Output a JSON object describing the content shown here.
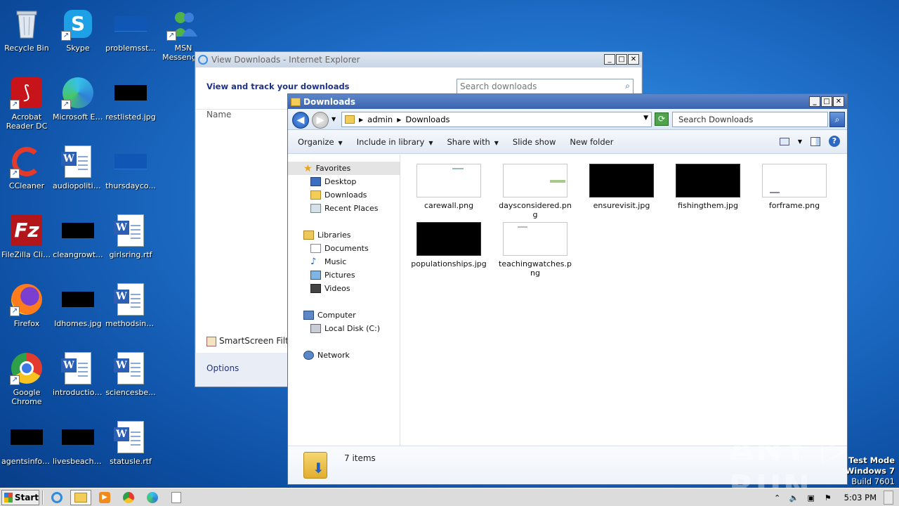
{
  "desktop": {
    "icons": [
      {
        "label": "Recycle Bin"
      },
      {
        "label": "Skype"
      },
      {
        "label": "problemsst..."
      },
      {
        "label": "MSN Messenger"
      },
      {
        "label": "Acrobat Reader DC"
      },
      {
        "label": "Microsoft Edge"
      },
      {
        "label": "restlisted.jpg"
      },
      {
        "label": "CCleaner"
      },
      {
        "label": "audiopolitic..."
      },
      {
        "label": "thursdayco..."
      },
      {
        "label": "FileZilla Client"
      },
      {
        "label": "cleangrowt..."
      },
      {
        "label": "girlsring.rtf"
      },
      {
        "label": "Firefox"
      },
      {
        "label": "ldhomes.jpg"
      },
      {
        "label": "methodsinc.rtf"
      },
      {
        "label": "Google Chrome"
      },
      {
        "label": "introduction..."
      },
      {
        "label": "sciencesbe..."
      },
      {
        "label": "agentsinfo.jpg"
      },
      {
        "label": "livesbeach.jpg"
      },
      {
        "label": "statusle.rtf"
      }
    ]
  },
  "ie_window": {
    "title": "View Downloads - Internet Explorer",
    "heading": "View and track your downloads",
    "search_placeholder": "Search downloads",
    "column_name": "Name",
    "smartscreen": "SmartScreen Filte",
    "options": "Options"
  },
  "explorer": {
    "title": "Downloads",
    "breadcrumb": [
      "admin",
      "Downloads"
    ],
    "search_placeholder": "Search Downloads",
    "toolbar": {
      "organize": "Organize",
      "include": "Include in library",
      "share": "Share with",
      "slideshow": "Slide show",
      "newfolder": "New folder"
    },
    "nav": {
      "favorites": "Favorites",
      "desktop": "Desktop",
      "downloads": "Downloads",
      "recent": "Recent Places",
      "libraries": "Libraries",
      "documents": "Documents",
      "music": "Music",
      "pictures": "Pictures",
      "videos": "Videos",
      "computer": "Computer",
      "localdisk": "Local Disk (C:)",
      "network": "Network"
    },
    "files": [
      {
        "name": "carewall.png"
      },
      {
        "name": "daysconsidered.png"
      },
      {
        "name": "ensurevisit.jpg"
      },
      {
        "name": "fishingthem.jpg"
      },
      {
        "name": "forframe.png"
      },
      {
        "name": "populationships.jpg"
      },
      {
        "name": "teachingwatches.png"
      }
    ],
    "item_count": "7 items"
  },
  "watermark": {
    "brand": "ANY ▷ RUN",
    "line1": "Test Mode",
    "line2": "Windows 7",
    "line3": "Build 7601"
  },
  "taskbar": {
    "start": "Start",
    "clock": "5:03 PM"
  }
}
